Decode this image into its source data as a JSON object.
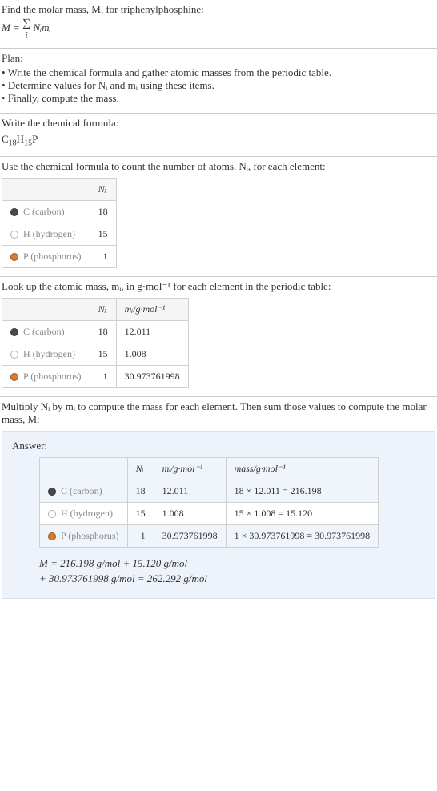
{
  "intro": {
    "line1": "Find the molar mass, M, for triphenylphosphine:",
    "formula_lhs": "M = ",
    "sum_sym": "∑",
    "sum_idx": "i",
    "formula_rhs": " Nᵢmᵢ"
  },
  "plan": {
    "title": "Plan:",
    "items": [
      "Write the chemical formula and gather atomic masses from the periodic table.",
      "Determine values for Nᵢ and mᵢ using these items.",
      "Finally, compute the mass."
    ]
  },
  "chem": {
    "title": "Write the chemical formula:",
    "C": "C",
    "Cn": "18",
    "H": "H",
    "Hn": "15",
    "P": "P"
  },
  "count": {
    "title": "Use the chemical formula to count the number of atoms, Nᵢ, for each element:",
    "h_ni": "Nᵢ",
    "rows": [
      {
        "sym": "C",
        "name": "C (carbon)",
        "ni": "18",
        "color": "#4a4a4a"
      },
      {
        "sym": "H",
        "name": "H (hydrogen)",
        "ni": "15",
        "color": "#ffffff"
      },
      {
        "sym": "P",
        "name": "P (phosphorus)",
        "ni": "1",
        "color": "#d97b2e"
      }
    ]
  },
  "masses": {
    "title": "Look up the atomic mass, mᵢ, in g·mol⁻¹ for each element in the periodic table:",
    "h_ni": "Nᵢ",
    "h_mi": "mᵢ/g·mol⁻¹",
    "rows": [
      {
        "name": "C (carbon)",
        "ni": "18",
        "mi": "12.011",
        "color": "#4a4a4a"
      },
      {
        "name": "H (hydrogen)",
        "ni": "15",
        "mi": "1.008",
        "color": "#ffffff"
      },
      {
        "name": "P (phosphorus)",
        "ni": "1",
        "mi": "30.973761998",
        "color": "#d97b2e"
      }
    ]
  },
  "multiply": {
    "title": "Multiply Nᵢ by mᵢ to compute the mass for each element. Then sum those values to compute the molar mass, M:"
  },
  "answer": {
    "label": "Answer:",
    "h_ni": "Nᵢ",
    "h_mi": "mᵢ/g·mol⁻¹",
    "h_mass": "mass/g·mol⁻¹",
    "rows": [
      {
        "name": "C (carbon)",
        "ni": "18",
        "mi": "12.011",
        "mass": "18 × 12.011 = 216.198",
        "color": "#4a4a4a"
      },
      {
        "name": "H (hydrogen)",
        "ni": "15",
        "mi": "1.008",
        "mass": "15 × 1.008 = 15.120",
        "color": "#ffffff"
      },
      {
        "name": "P (phosphorus)",
        "ni": "1",
        "mi": "30.973761998",
        "mass": "1 × 30.973761998 = 30.973761998",
        "color": "#d97b2e"
      }
    ],
    "sum1": "M = 216.198 g/mol + 15.120 g/mol",
    "sum2": "  + 30.973761998 g/mol = 262.292 g/mol"
  }
}
